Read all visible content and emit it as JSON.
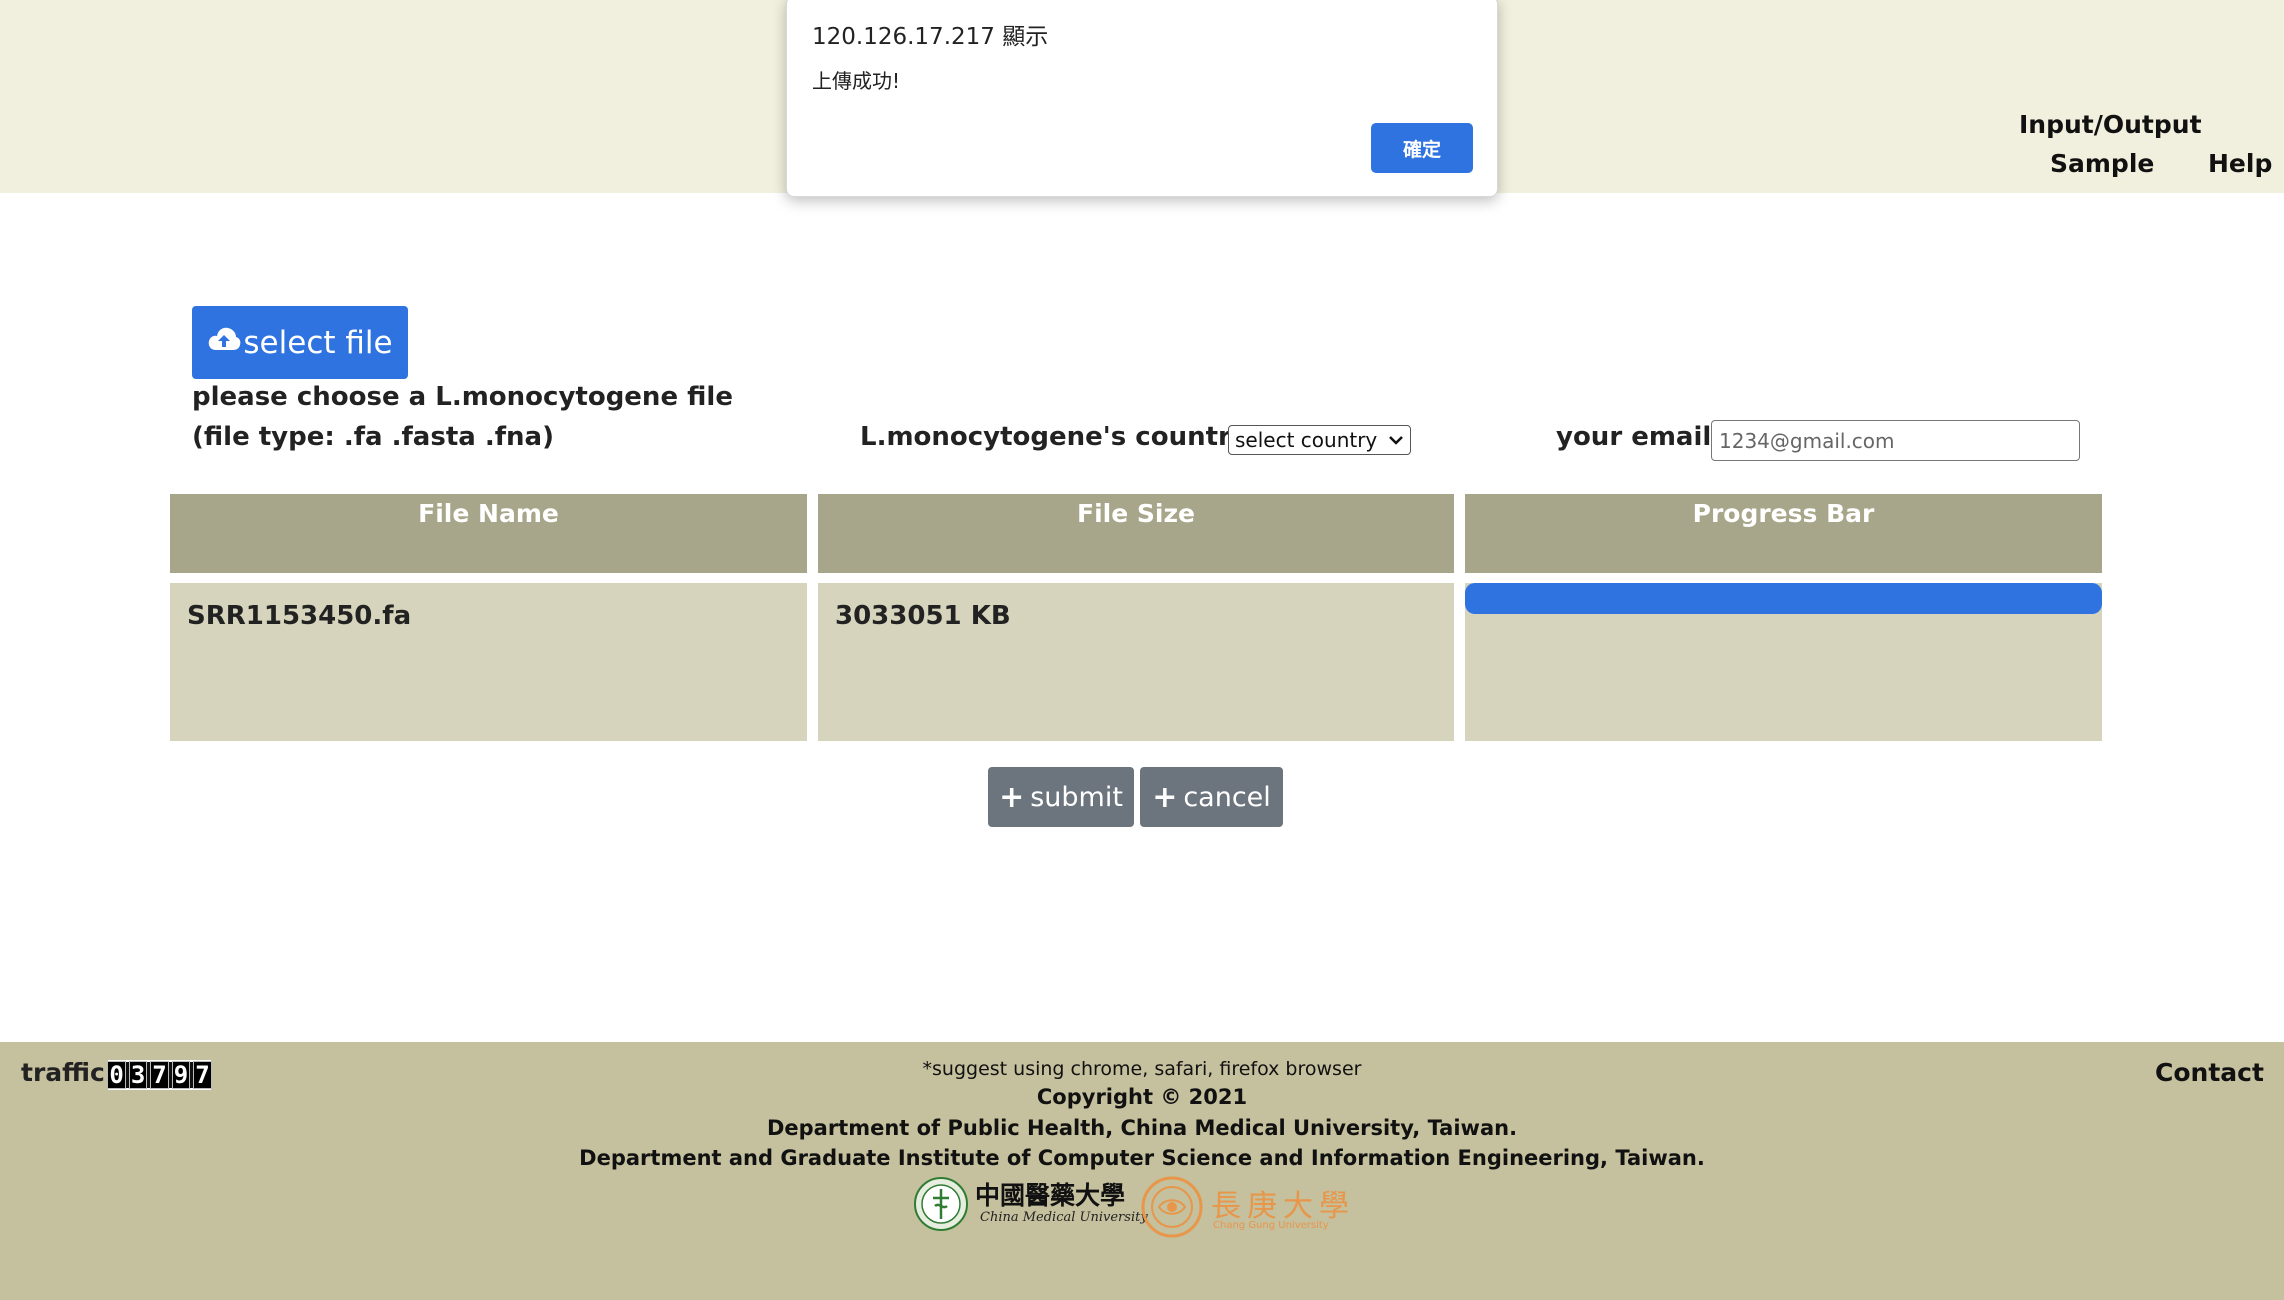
{
  "dialog": {
    "title": "120.126.17.217 顯示",
    "message": "上傳成功!",
    "ok_label": "確定"
  },
  "nav": {
    "input_output": "Input/Output",
    "sample": "Sample",
    "help": "Help"
  },
  "upload": {
    "select_button_label": "select file",
    "select_button_icon": "cloud-upload-icon",
    "instruction_line1": "please choose a L.monocytogene file",
    "instruction_line2": "(file type: .fa .fasta .fna)",
    "country_label": "L.monocytogene's country:",
    "country_selected": "select country",
    "email_label": "your email:",
    "email_placeholder": "1234@gmail.com"
  },
  "table": {
    "headers": [
      "File Name",
      "File Size",
      "Progress Bar"
    ],
    "rows": [
      {
        "file_name": "SRR1153450.fa",
        "file_size": "3033051 KB",
        "progress": 1.0
      }
    ]
  },
  "actions": {
    "submit_label": "submit",
    "cancel_label": "cancel"
  },
  "footer": {
    "traffic_label": "traffic:",
    "traffic_count": "03797",
    "suggest": "*suggest using chrome, safari, firefox browser",
    "copyright": "Copyright © 2021",
    "dept1": "Department of Public Health, China Medical University, Taiwan.",
    "dept2": "Department and Graduate Institute of Computer Science and Information Engineering, Taiwan.",
    "contact": "Contact",
    "logo1_cn": "中國醫藥大學",
    "logo1_en": "China Medical University",
    "logo2_cn": "長庚大學",
    "logo2_en": "Chang Gung University"
  },
  "colors": {
    "accent_blue": "#2f73e0",
    "header_bg": "#f1f0de",
    "table_header": "#a8a68a",
    "table_cell": "#d6d4bc",
    "footer_bg": "#c5c09d",
    "button_gray": "#6c757d"
  }
}
